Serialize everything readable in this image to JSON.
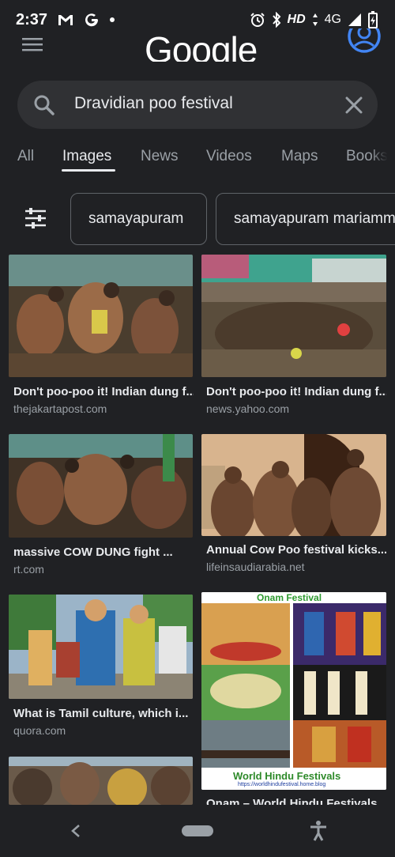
{
  "status_bar": {
    "time": "2:37",
    "network_label": "HD",
    "signal_label": "4G",
    "icons": [
      "gmail-icon",
      "google-g-icon",
      "dot-icon",
      "alarm-icon",
      "bluetooth-icon",
      "data-arrows-icon",
      "signal-icon",
      "battery-charging-icon"
    ]
  },
  "header": {
    "logo_text": "Google"
  },
  "search": {
    "query": "Dravidian poo festival"
  },
  "tabs": [
    {
      "label": "All"
    },
    {
      "label": "Images"
    },
    {
      "label": "News"
    },
    {
      "label": "Videos"
    },
    {
      "label": "Maps"
    },
    {
      "label": "Books"
    }
  ],
  "active_tab": "Images",
  "chips": [
    {
      "label": "samayapuram"
    },
    {
      "label": "samayapuram mariamman"
    }
  ],
  "results": [
    {
      "title": "Don't poo-poo it! Indian dung f...",
      "source": "thejakartapost.com"
    },
    {
      "title": "Don't poo-poo it! Indian dung f...",
      "source": "news.yahoo.com"
    },
    {
      "title": "massive COW DUNG fight ...",
      "source": "rt.com"
    },
    {
      "title": "Annual Cow Poo festival kicks...",
      "source": "lifeinsaudiarabia.net"
    },
    {
      "title": "What is Tamil culture, which i...",
      "source": "quora.com"
    },
    {
      "title": "Onam – World Hindu Festivals",
      "source": ""
    },
    {
      "title": "",
      "source": ""
    }
  ],
  "image_texts": {
    "onam_header": "Onam Festival",
    "onam_footer": "World Hindu Festivals",
    "onam_url": "https://worldhindufestival.home.blog"
  },
  "colors": {
    "background": "#202124",
    "surface": "#303134",
    "text_primary": "#e8eaed",
    "text_secondary": "#9aa0a6",
    "accent_blue": "#4285f4"
  }
}
